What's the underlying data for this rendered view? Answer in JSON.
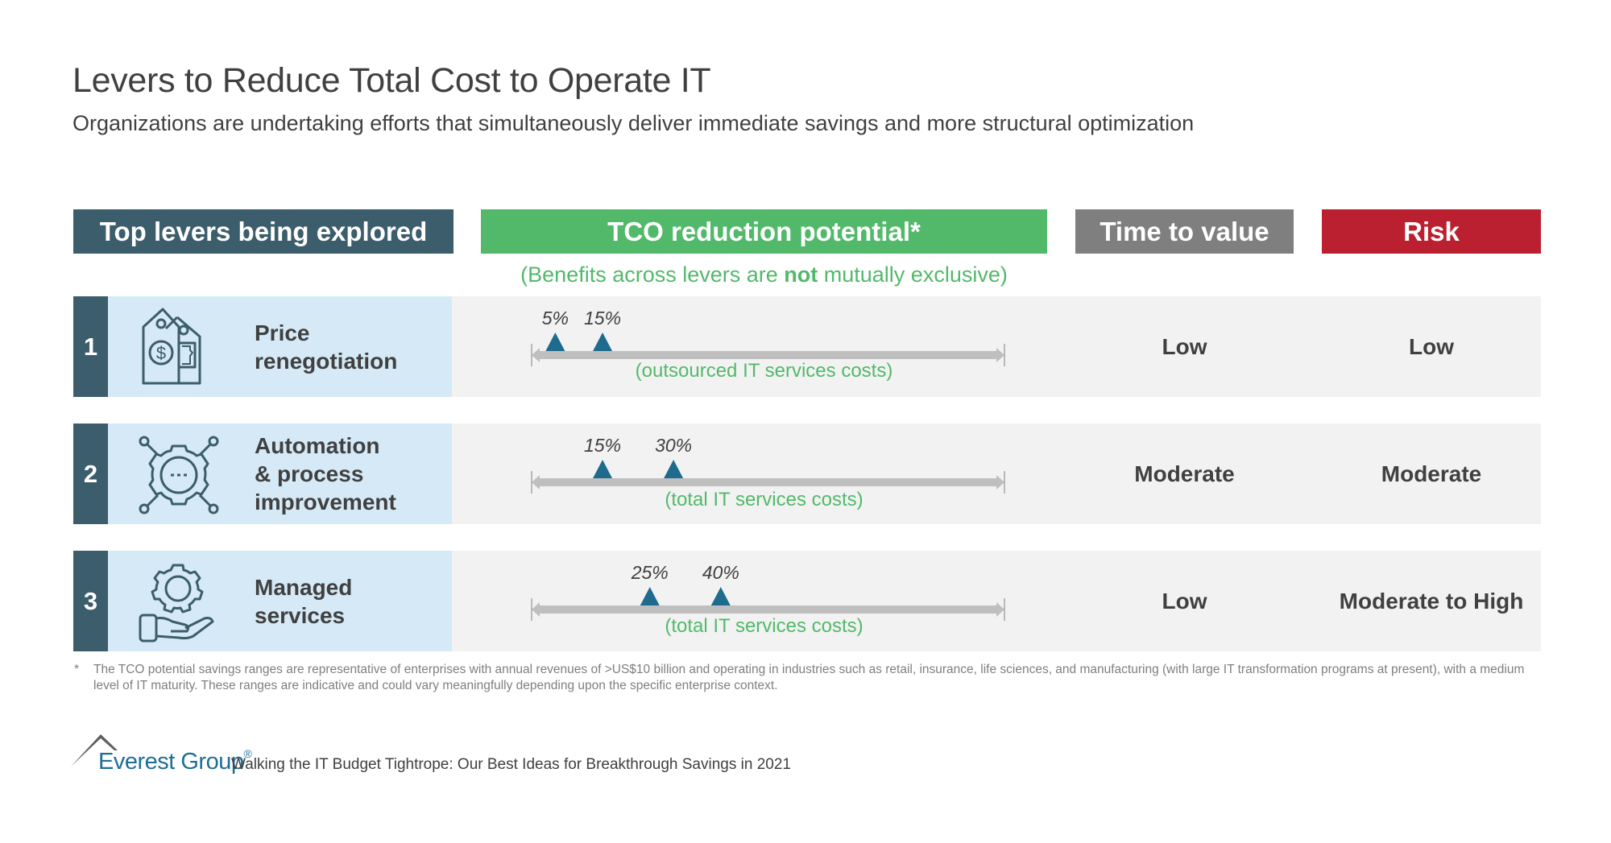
{
  "header": {
    "title": "Levers to Reduce Total Cost to Operate IT",
    "subtitle": "Organizations are undertaking efforts that simultaneously deliver immediate savings and more structural optimization"
  },
  "columns": {
    "levers": "Top levers being explored",
    "tco": "TCO reduction potential*",
    "time_to_value": "Time to value",
    "risk": "Risk"
  },
  "benefits_note": {
    "before": "(Benefits across levers are ",
    "emphasis": "not",
    "after": " mutually exclusive)"
  },
  "colors": {
    "levers_header": "#3c5d6b",
    "tco_header": "#52b96a",
    "time_header": "#7f7f7f",
    "risk_header": "#ba202f",
    "marker": "#1f6b8e",
    "axis": "#bfbfbf",
    "brand": "#1f6e96"
  },
  "rows": [
    {
      "number": "1",
      "icon": "price-tags-icon",
      "lever": "Price\nrenegotiation",
      "tco_low": 5,
      "tco_high": 15,
      "tco_low_label": "5%",
      "tco_high_label": "15%",
      "tco_basis": "(outsourced IT services costs)",
      "time_to_value": "Low",
      "risk": "Low"
    },
    {
      "number": "2",
      "icon": "automation-gear-icon",
      "lever": "Automation\n& process\nimprovement",
      "tco_low": 15,
      "tco_high": 30,
      "tco_low_label": "15%",
      "tco_high_label": "30%",
      "tco_basis": "(total IT services costs)",
      "time_to_value": "Moderate",
      "risk": "Moderate"
    },
    {
      "number": "3",
      "icon": "managed-services-hand-gear-icon",
      "lever": "Managed\nservices",
      "tco_low": 25,
      "tco_high": 40,
      "tco_low_label": "25%",
      "tco_high_label": "40%",
      "tco_basis": "(total IT services costs)",
      "time_to_value": "Low",
      "risk": "Moderate to High"
    }
  ],
  "axis_range_percent": [
    0,
    100
  ],
  "footnote": {
    "marker": "*",
    "text": "The TCO potential savings ranges are representative of enterprises with annual revenues of >US$10 billion and operating in industries such as retail, insurance, life sciences, and manufacturing (with large IT transformation programs at present), with a medium level of IT maturity. These ranges are indicative and could vary meaningfully depending upon the specific enterprise context."
  },
  "footer": {
    "brand": "Everest Group",
    "registered": "®",
    "report_title": "Walking the IT Budget Tightrope: Our Best Ideas for Breakthrough Savings in 2021"
  }
}
